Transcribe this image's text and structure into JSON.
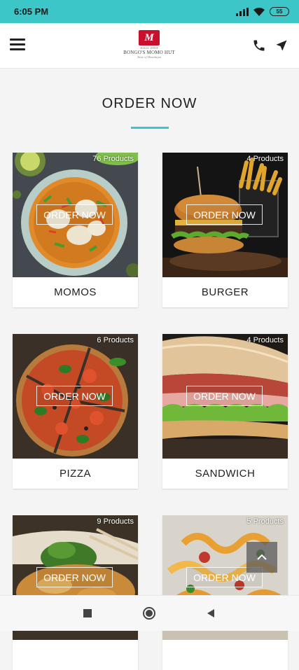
{
  "status_bar": {
    "time": "6:05 PM",
    "battery": "55"
  },
  "header": {
    "logo_tiny": "Since 2003",
    "logo_name": "BONGO'S MOMO HUT",
    "logo_tagline": "Taste of Himalayas"
  },
  "page": {
    "title": "ORDER NOW"
  },
  "categories": [
    {
      "name": "MOMOS",
      "count": "76 Products",
      "button": "ORDER NOW"
    },
    {
      "name": "BURGER",
      "count": "4 Products",
      "button": "ORDER NOW"
    },
    {
      "name": "PIZZA",
      "count": "6 Products",
      "button": "ORDER NOW"
    },
    {
      "name": "SANDWICH",
      "count": "4 Products",
      "button": "ORDER NOW"
    },
    {
      "name": "",
      "count": "9 Products",
      "button": "ORDER NOW"
    },
    {
      "name": "",
      "count": "5 Products",
      "button": "ORDER NOW"
    }
  ],
  "colors": {
    "accent": "#3cc6c8",
    "brand": "#c8102e"
  },
  "icons": [
    "menu-icon",
    "phone-icon",
    "navigation-icon",
    "chevron-up-icon",
    "square-icon",
    "circle-icon",
    "back-triangle-icon",
    "wifi-icon",
    "signal-icon",
    "battery-icon"
  ]
}
